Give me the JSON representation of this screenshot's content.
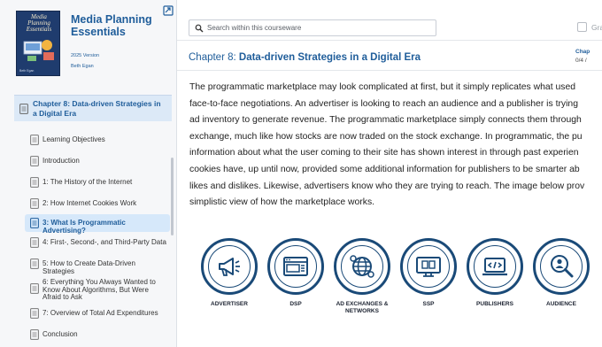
{
  "sidebar": {
    "book": {
      "cover_title": "Media Planning Essentials",
      "cover_author": "Beth Egan",
      "title": "Media Planning Essentials",
      "version": "2025 Version",
      "author": "Beth Egan"
    },
    "chapter_label": "Chapter 8: Data-driven Strategies in a Digital Era",
    "items": [
      {
        "label": "Learning Objectives",
        "active": false
      },
      {
        "label": "Introduction",
        "active": false
      },
      {
        "label": "1: The History of the Internet",
        "active": false
      },
      {
        "label": "2: How Internet Cookies Work",
        "active": false
      },
      {
        "label": "3: What Is Programmatic Advertising?",
        "active": true
      },
      {
        "label": "4: First-, Second-, and Third-Party Data",
        "active": false
      },
      {
        "label": "5: How to Create Data-Driven Strategies",
        "active": false
      },
      {
        "label": "6: Everything You Always Wanted to Know About Algorithms, But Were Afraid to Ask",
        "active": false
      },
      {
        "label": "7: Overview of Total Ad Expenditures",
        "active": false
      },
      {
        "label": "Conclusion",
        "active": false
      }
    ]
  },
  "topbar": {
    "search_placeholder": "Search within this courseware",
    "grade_label": "Gra"
  },
  "chapter": {
    "prefix": "Chapter 8: ",
    "name": "Data-driven Strategies in a Digital Era",
    "side_label": "Chap",
    "side_progress": "0/4 /"
  },
  "body_lines": [
    "The programmatic marketplace may look complicated at first, but it simply replicates what used",
    "face-to-face negotiations. An advertiser is looking to reach an audience and a publisher is trying",
    "ad inventory to generate revenue. The programmatic marketplace simply connects them through",
    "exchange, much like how stocks are now traded on the stock exchange. In programmatic, the pu",
    "information about what the user coming to their site has shown interest in through past experien",
    "cookies have, up until now, provided some additional information for publishers to be smarter ab",
    "likes and dislikes. Likewise, advertisers know who they are trying to reach. The image below prov",
    "simplistic view of how the marketplace works."
  ],
  "diagram": {
    "nodes": [
      {
        "label": "ADVERTISER",
        "icon": "megaphone-icon"
      },
      {
        "label": "DSP",
        "icon": "browser-dsp-icon"
      },
      {
        "label": "AD EXCHANGES & NETWORKS",
        "icon": "globe-network-icon"
      },
      {
        "label": "SSP",
        "icon": "monitor-ssp-icon"
      },
      {
        "label": "PUBLISHERS",
        "icon": "laptop-code-icon"
      },
      {
        "label": "AUDIENCE",
        "icon": "person-search-icon"
      }
    ],
    "color": "#1a4a78"
  },
  "colors": {
    "accent": "#1f5d9a",
    "active_bg": "#d6e8fa",
    "sidebar_bg": "#f6f7f9"
  }
}
